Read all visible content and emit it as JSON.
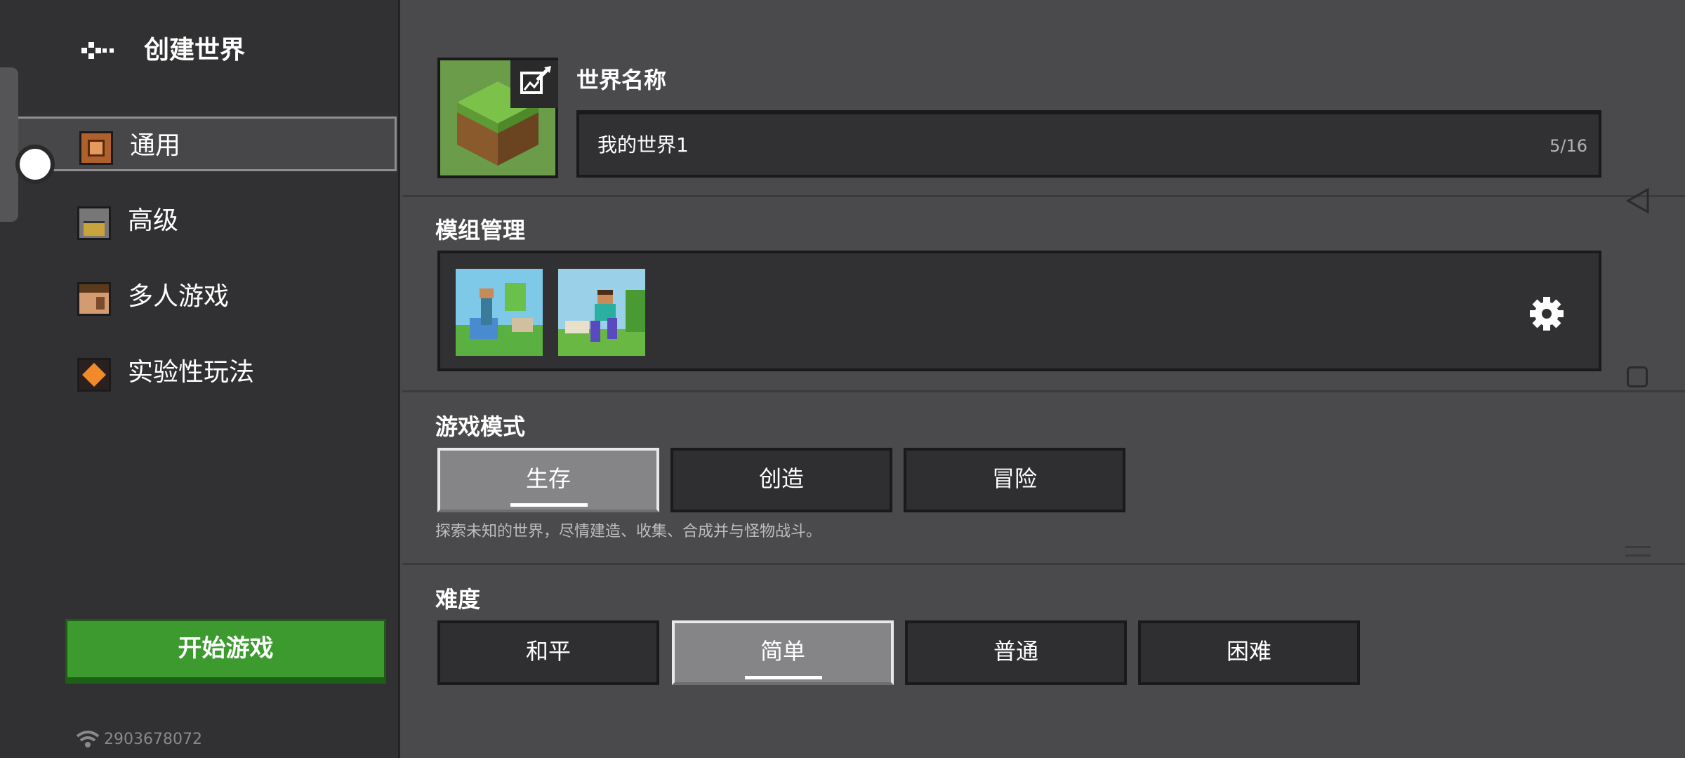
{
  "sidebar": {
    "title": "创建世界",
    "items": [
      {
        "label": "通用",
        "icon": "general-settings-icon",
        "active": true
      },
      {
        "label": "高级",
        "icon": "advanced-chest-icon",
        "active": false
      },
      {
        "label": "多人游戏",
        "icon": "multiplayer-steve-icon",
        "active": false
      },
      {
        "label": "实验性玩法",
        "icon": "experimental-icon",
        "active": false
      }
    ],
    "start_button": "开始游戏",
    "network_id": "2903678072"
  },
  "world": {
    "name_label": "世界名称",
    "name_value": "我的世界1",
    "char_count": "5/16"
  },
  "mods": {
    "label": "模组管理",
    "items": [
      "mod-pack-1",
      "mod-pack-2"
    ]
  },
  "game_mode": {
    "label": "游戏模式",
    "options": [
      "生存",
      "创造",
      "冒险"
    ],
    "selected": "生存",
    "description": "探索未知的世界，尽情建造、收集、合成并与怪物战斗。"
  },
  "difficulty": {
    "label": "难度",
    "options": [
      "和平",
      "简单",
      "普通",
      "困难"
    ],
    "selected": "简单"
  },
  "colors": {
    "accent": "#3c9a2f",
    "panel": "#313133",
    "background": "#4a4a4c"
  }
}
